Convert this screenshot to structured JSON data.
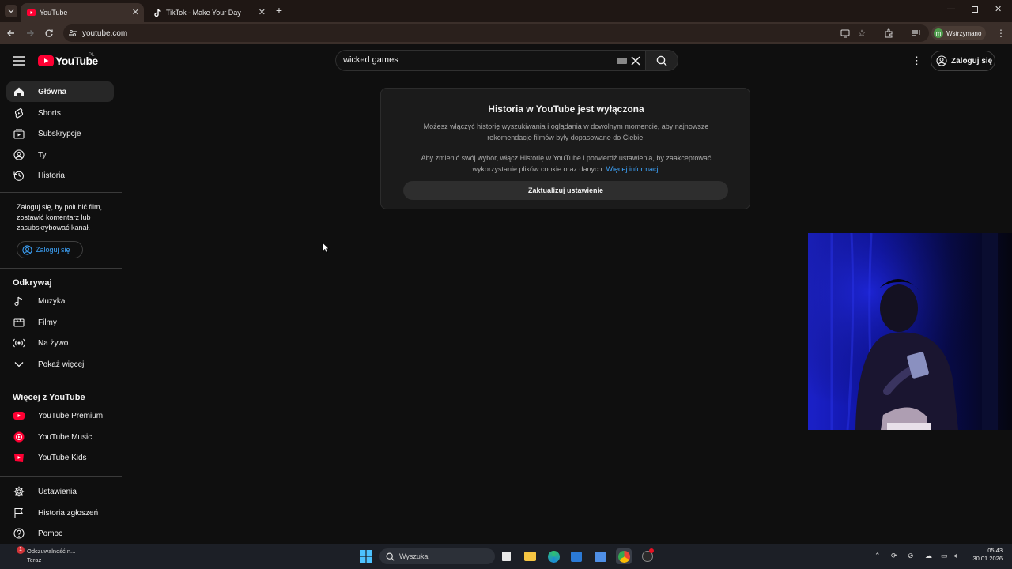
{
  "browser": {
    "tabs": [
      {
        "title": "YouTube",
        "active": true
      },
      {
        "title": "TikTok - Make Your Day",
        "active": false
      }
    ],
    "url": "youtube.com",
    "profile_label": "Wstrzymano",
    "profile_initial": "m"
  },
  "header": {
    "logo_text": "YouTube",
    "logo_region": "PL",
    "search_value": "wicked games",
    "signin_label": "Zaloguj się"
  },
  "sidebar": {
    "main": [
      {
        "label": "Główna",
        "icon": "home-icon",
        "selected": true
      },
      {
        "label": "Shorts",
        "icon": "shorts-icon"
      },
      {
        "label": "Subskrypcje",
        "icon": "subscriptions-icon"
      },
      {
        "label": "Ty",
        "icon": "you-icon"
      },
      {
        "label": "Historia",
        "icon": "history-icon"
      }
    ],
    "signin_note": "Zaloguj się, by polubić film, zostawić komentarz lub zasubskrybować kanał.",
    "signin_button": "Zaloguj się",
    "explore_title": "Odkrywaj",
    "explore": [
      {
        "label": "Muzyka",
        "icon": "music-icon"
      },
      {
        "label": "Filmy",
        "icon": "film-icon"
      },
      {
        "label": "Na żywo",
        "icon": "live-icon"
      },
      {
        "label": "Pokaż więcej",
        "icon": "chevron-down-icon"
      }
    ],
    "more_title": "Więcej z YouTube",
    "more": [
      {
        "label": "YouTube Premium",
        "icon": "yt-premium-icon"
      },
      {
        "label": "YouTube Music",
        "icon": "yt-music-icon"
      },
      {
        "label": "YouTube Kids",
        "icon": "yt-kids-icon"
      }
    ],
    "settings": [
      {
        "label": "Ustawienia",
        "icon": "gear-icon"
      },
      {
        "label": "Historia zgłoszeń",
        "icon": "flag-icon"
      },
      {
        "label": "Pomoc",
        "icon": "help-icon"
      }
    ]
  },
  "notice": {
    "title": "Historia w YouTube jest wyłączona",
    "p1": "Możesz włączyć historię wyszukiwania i oglądania w dowolnym momencie, aby najnowsze rekomendacje filmów były dopasowane do Ciebie.",
    "p2": "Aby zmienić swój wybór, włącz Historię w YouTube i potwierdź ustawienia, by zaakceptować wykorzystanie plików cookie oraz danych.",
    "link": "Więcej informacji",
    "button": "Zaktualizuj ustawienie"
  },
  "taskbar": {
    "search_placeholder": "Wyszukaj",
    "notification_title": "Odczuwalność n...",
    "notification_sub": "Teraz",
    "notification_count": "1",
    "time": "05:43",
    "date": "30.01.2026"
  },
  "colors": {
    "background": "#0f0f0f",
    "youtube_red": "#ff0033",
    "link_blue": "#3ea6ff"
  }
}
